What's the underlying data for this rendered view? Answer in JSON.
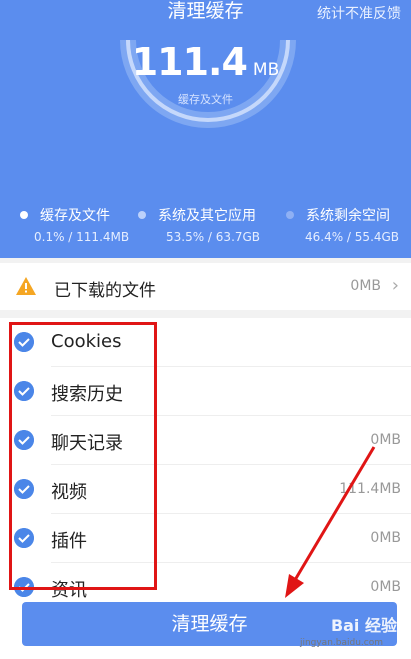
{
  "header": {
    "title": "清理缓存",
    "feedback_link": "统计不准反馈",
    "cache_size": "111.4",
    "cache_unit": "MB",
    "cache_sublabel": "缓存及文件",
    "legend": [
      {
        "label": "缓存及文件",
        "stat": "0.1% / 111.4MB"
      },
      {
        "label": "系统及其它应用",
        "stat": "53.5% / 63.7GB"
      },
      {
        "label": "系统剩余空间",
        "stat": "46.4% / 55.4GB"
      }
    ]
  },
  "downloads": {
    "label": "已下载的文件",
    "size": "0MB",
    "chevron": "›"
  },
  "items": [
    {
      "label": "Cookies",
      "size": ""
    },
    {
      "label": "搜索历史",
      "size": ""
    },
    {
      "label": "聊天记录",
      "size": "0MB"
    },
    {
      "label": "视频",
      "size": "111.4MB"
    },
    {
      "label": "插件",
      "size": "0MB"
    },
    {
      "label": "资讯",
      "size": "0MB"
    }
  ],
  "bottom": {
    "button_label": "清理缓存",
    "watermark": "Bai 经验",
    "watermark_url": "jingyan.baidu.com"
  },
  "colors": {
    "primary": "#5b8dee",
    "check": "#4b86e8",
    "annotation": "#e01515",
    "warning": "#f5a623"
  }
}
